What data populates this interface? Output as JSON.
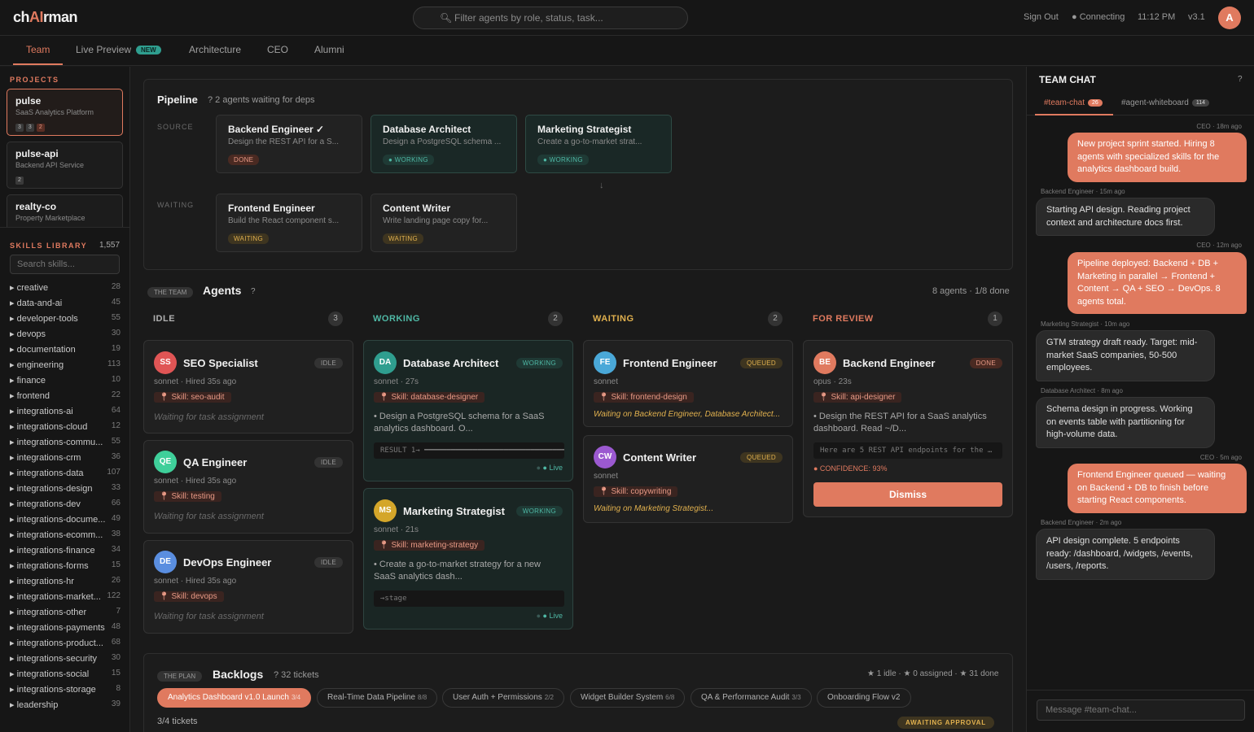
{
  "app": {
    "logo_pre": "ch",
    "logo_ai": "AI",
    "logo_post": "rman"
  },
  "search": {
    "placeholder": "Filter agents by role, status, task..."
  },
  "topright": {
    "signout": "Sign Out",
    "connecting": "● Connecting",
    "time": "11:12 PM",
    "version": "v3.1",
    "avatar": "A"
  },
  "tabs": [
    {
      "label": "Team"
    },
    {
      "label": "Live Preview",
      "badge": "NEW"
    },
    {
      "label": "Architecture"
    },
    {
      "label": "CEO"
    },
    {
      "label": "Alumni"
    }
  ],
  "sidebar": {
    "projects_header": "PROJECTS",
    "projects": [
      {
        "name": "pulse",
        "desc": "SaaS Analytics Platform",
        "chips": [
          "3",
          "3",
          "2"
        ]
      },
      {
        "name": "pulse-api",
        "desc": "Backend API Service",
        "chips": [
          "2"
        ]
      },
      {
        "name": "realty-co",
        "desc": "Property Marketplace"
      }
    ],
    "skills_header": "SKILLS LIBRARY",
    "skills_count": "1,557",
    "skills_search_placeholder": "Search skills...",
    "skills": [
      {
        "name": "▸ creative",
        "count": "28"
      },
      {
        "name": "▸ data-and-ai",
        "count": "45"
      },
      {
        "name": "▸ developer-tools",
        "count": "55"
      },
      {
        "name": "▸ devops",
        "count": "30"
      },
      {
        "name": "▸ documentation",
        "count": "19"
      },
      {
        "name": "▸ engineering",
        "count": "113"
      },
      {
        "name": "▸ finance",
        "count": "10"
      },
      {
        "name": "▸ frontend",
        "count": "22"
      },
      {
        "name": "▸ integrations-ai",
        "count": "64"
      },
      {
        "name": "▸ integrations-cloud",
        "count": "12"
      },
      {
        "name": "▸ integrations-commu...",
        "count": "55"
      },
      {
        "name": "▸ integrations-crm",
        "count": "36"
      },
      {
        "name": "▸ integrations-data",
        "count": "107"
      },
      {
        "name": "▸ integrations-design",
        "count": "33"
      },
      {
        "name": "▸ integrations-dev",
        "count": "66"
      },
      {
        "name": "▸ integrations-docume...",
        "count": "49"
      },
      {
        "name": "▸ integrations-ecomm...",
        "count": "38"
      },
      {
        "name": "▸ integrations-finance",
        "count": "34"
      },
      {
        "name": "▸ integrations-forms",
        "count": "15"
      },
      {
        "name": "▸ integrations-hr",
        "count": "26"
      },
      {
        "name": "▸ integrations-market...",
        "count": "122"
      },
      {
        "name": "▸ integrations-other",
        "count": "7"
      },
      {
        "name": "▸ integrations-payments",
        "count": "48"
      },
      {
        "name": "▸ integrations-product...",
        "count": "68"
      },
      {
        "name": "▸ integrations-security",
        "count": "30"
      },
      {
        "name": "▸ integrations-social",
        "count": "15"
      },
      {
        "name": "▸ integrations-storage",
        "count": "8"
      },
      {
        "name": "▸ leadership",
        "count": "39"
      }
    ]
  },
  "pipeline": {
    "title": "Pipeline",
    "subtitle": "? 2 agents waiting for deps",
    "source_label": "SOURCE",
    "waiting_label": "WAITING",
    "arrow": "↓",
    "source": [
      {
        "title": "Backend Engineer ✓",
        "desc": "Design the REST API for a S...",
        "status": "DONE"
      },
      {
        "title": "Database Architect",
        "desc": "Design a PostgreSQL schema ...",
        "status": "● WORKING"
      },
      {
        "title": "Marketing Strategist",
        "desc": "Create a go-to-market strat...",
        "status": "● WORKING"
      }
    ],
    "waiting": [
      {
        "title": "Frontend Engineer",
        "desc": "Build the React component s...",
        "status": "WAITING"
      },
      {
        "title": "Content Writer",
        "desc": "Write landing page copy for...",
        "status": "WAITING"
      }
    ]
  },
  "agents": {
    "tag": "THE TEAM",
    "title": "Agents",
    "help": "?",
    "summary": "8 agents · 1/8 done",
    "columns": [
      {
        "label": "IDLE",
        "count": "3",
        "color": "#b0b0b0"
      },
      {
        "label": "WORKING",
        "count": "2",
        "color": "#4fb8a5"
      },
      {
        "label": "WAITING",
        "count": "2",
        "color": "#e0b04e"
      },
      {
        "label": "FOR REVIEW",
        "count": "1",
        "color": "#e07a5f"
      }
    ],
    "idle": [
      {
        "initials": "SS",
        "name": "SEO Specialist",
        "status": "IDLE",
        "meta": "sonnet · Hired 35s ago",
        "skill": "Skill: seo-audit",
        "note": "Waiting for task assignment",
        "color": "#e05555"
      },
      {
        "initials": "QE",
        "name": "QA Engineer",
        "status": "IDLE",
        "meta": "sonnet · Hired 35s ago",
        "skill": "Skill: testing",
        "note": "Waiting for task assignment",
        "color": "#3fcf9a"
      },
      {
        "initials": "DE",
        "name": "DevOps Engineer",
        "status": "IDLE",
        "meta": "sonnet · Hired 35s ago",
        "skill": "Skill: devops",
        "note": "Waiting for task assignment",
        "color": "#5a8ee0"
      }
    ],
    "working": [
      {
        "initials": "DA",
        "name": "Database Architect",
        "status": "WORKING",
        "meta": "sonnet · 27s",
        "skill": "Skill: database-designer",
        "desc": "• Design a PostgreSQL schema for a SaaS analytics dashboard. O...",
        "result": "RESULT 1→ ━━━━━━━━━━━━━━━━━━━━━━━━━━━━━━━━…",
        "live": "● Live",
        "color": "#2f9e8f"
      },
      {
        "initials": "MS",
        "name": "Marketing Strategist",
        "status": "WORKING",
        "meta": "sonnet · 21s",
        "skill": "Skill: marketing-strategy",
        "desc": "• Create a go-to-market strategy for a new SaaS analytics dash...",
        "result": "→stage",
        "live": "● Live",
        "color": "#d4a62a"
      }
    ],
    "waiting": [
      {
        "initials": "FE",
        "name": "Frontend Engineer",
        "status": "QUEUED",
        "meta": "sonnet",
        "skill": "Skill: frontend-design",
        "note": "Waiting on Backend Engineer, Database Architect...",
        "color": "#4aa8d8"
      },
      {
        "initials": "CW",
        "name": "Content Writer",
        "status": "QUEUED",
        "meta": "sonnet",
        "skill": "Skill: copywriting",
        "note": "Waiting on Marketing Strategist...",
        "color": "#9b59d0"
      }
    ],
    "review": [
      {
        "initials": "BE",
        "name": "Backend Engineer",
        "status": "DONE",
        "meta": "opus · 23s",
        "skill": "Skill: api-designer",
        "desc": "• Design the REST API for a SaaS analytics dashboard. Read ~/D...",
        "result": "Here are 5 REST API endpoints for the …",
        "confidence": "● CONFIDENCE: 93%",
        "dismiss": "Dismiss",
        "color": "#e07a5f"
      }
    ]
  },
  "backlogs": {
    "tag": "THE PLAN",
    "title": "Backlogs",
    "subtitle": "? 32 tickets",
    "summary": "★ 1 idle · ★ 0 assigned · ★ 31 done",
    "tabs": [
      {
        "label": "Analytics Dashboard v1.0 Launch",
        "n": "3/4"
      },
      {
        "label": "Real-Time Data Pipeline",
        "n": "8/8"
      },
      {
        "label": "User Auth + Permissions",
        "n": "2/2"
      },
      {
        "label": "Widget Builder System",
        "n": "6/8"
      },
      {
        "label": "QA & Performance Audit",
        "n": "3/3"
      },
      {
        "label": "Onboarding Flow v2",
        "n": ""
      }
    ],
    "tickets": "3/4 tickets",
    "approval": "AWAITING APPROVAL"
  },
  "chat": {
    "title": "TEAM CHAT",
    "help": "?",
    "tabs": [
      {
        "label": "#team-chat",
        "badge": "26"
      },
      {
        "label": "#agent-whiteboard",
        "badge": "114"
      }
    ],
    "messages": [
      {
        "meta": "CEO · 18m ago",
        "text": "New project sprint started. Hiring 8 agents with specialized skills for the analytics dashboard build.",
        "mine": true
      },
      {
        "meta": "Backend Engineer · 15m ago",
        "text": "Starting API design. Reading project context and architecture docs first.",
        "mine": false
      },
      {
        "meta": "CEO · 12m ago",
        "text": "Pipeline deployed: Backend + DB + Marketing in parallel → Frontend + Content → QA + SEO → DevOps. 8 agents total.",
        "mine": true
      },
      {
        "meta": "Marketing Strategist · 10m ago",
        "text": "GTM strategy draft ready. Target: mid-market SaaS companies, 50-500 employees.",
        "mine": false
      },
      {
        "meta": "Database Architect · 8m ago",
        "text": "Schema design in progress. Working on events table with partitioning for high-volume data.",
        "mine": false
      },
      {
        "meta": "CEO · 5m ago",
        "text": "Frontend Engineer queued — waiting on Backend + DB to finish before starting React components.",
        "mine": true
      },
      {
        "meta": "Backend Engineer · 2m ago",
        "text": "API design complete. 5 endpoints ready: /dashboard, /widgets, /events, /users, /reports.",
        "mine": false
      }
    ],
    "input_placeholder": "Message #team-chat..."
  }
}
